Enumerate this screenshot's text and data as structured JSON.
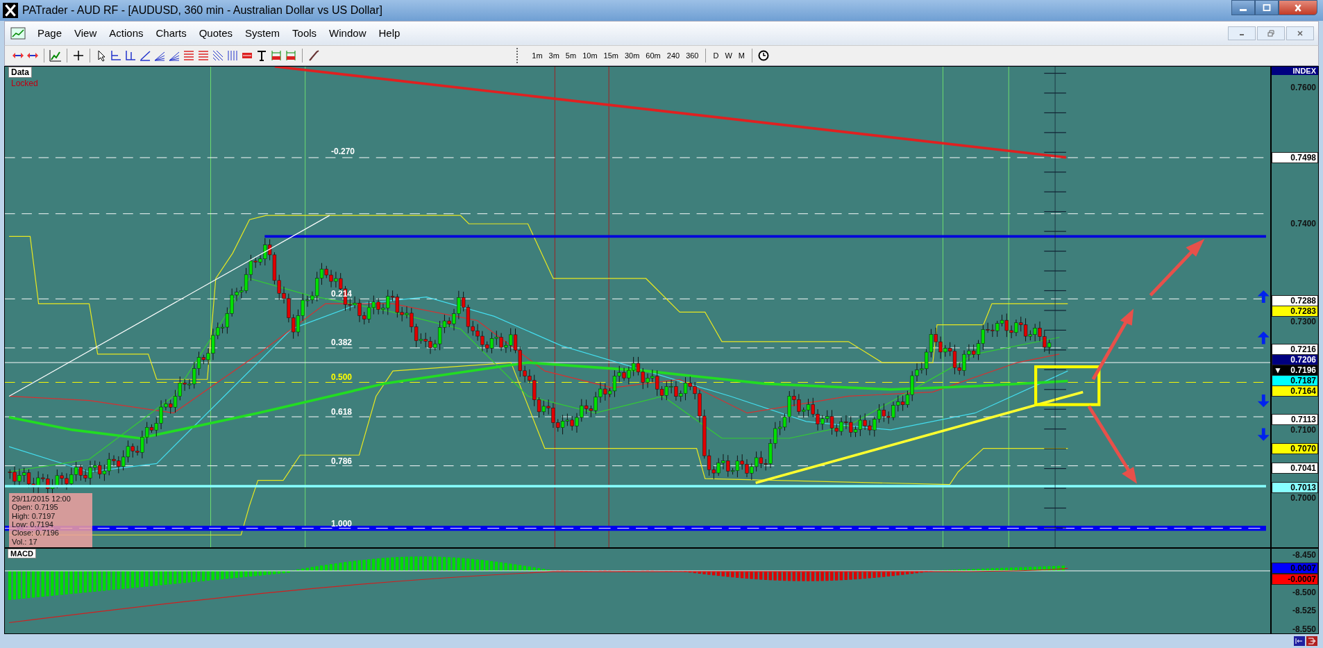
{
  "window": {
    "title": "PATrader - AUD RF - [AUDUSD, 360 min - Australian Dollar vs US Dollar]"
  },
  "menu": [
    "Page",
    "View",
    "Actions",
    "Charts",
    "Quotes",
    "System",
    "Tools",
    "Window",
    "Help"
  ],
  "timeframes": [
    "1m",
    "3m",
    "5m",
    "10m",
    "15m",
    "30m",
    "60m",
    "240",
    "360"
  ],
  "periods": [
    "D",
    "W",
    "M"
  ],
  "chart": {
    "data_tab": "Data",
    "lock_status": "Locked",
    "index_label": "INDEX",
    "axis_labels": [
      "0.7600",
      "0.7400",
      "0.7300",
      "0.7100",
      "0.7000"
    ],
    "price_tags": [
      {
        "text": "0.7498",
        "color": "#ffffff"
      },
      {
        "text": "0.7288",
        "color": "#ffffff"
      },
      {
        "text": "0.7283",
        "color": "#ffff00"
      },
      {
        "text": "0.7216",
        "color": "#ffffff"
      },
      {
        "text": "0.7206",
        "color": "#000080"
      },
      {
        "text": "0.7196",
        "color": "#000000",
        "marker": "▼"
      },
      {
        "text": "0.7187",
        "color": "#00ffff"
      },
      {
        "text": "0.7164",
        "color": "#ffff00"
      },
      {
        "text": "0.7113",
        "color": "#ffffff"
      },
      {
        "text": "0.7070",
        "color": "#ffff00"
      },
      {
        "text": "0.7041",
        "color": "#ffffff"
      },
      {
        "text": "0.7013",
        "color": "#88ffff"
      }
    ],
    "fib_labels": [
      {
        "text": "-0.270",
        "color": "#ffffff"
      },
      {
        "text": "0.214",
        "color": "#ffffff"
      },
      {
        "text": "0.382",
        "color": "#ffffff"
      },
      {
        "text": "0.500",
        "color": "#ffff00"
      },
      {
        "text": "0.618",
        "color": "#ffffff"
      },
      {
        "text": "0.786",
        "color": "#ffffff"
      },
      {
        "text": "1.000",
        "color": "#ffffff"
      }
    ],
    "data_box": [
      "29/11/2015 12:00",
      "Open: 0.7195",
      "High: 0.7197",
      "Low: 0.7194",
      "Close: 0.7196",
      "Vol.: 17"
    ]
  },
  "macd": {
    "tab": "MACD",
    "axis_labels": [
      "-8.450",
      "-8.500",
      "-8.525",
      "-8.550"
    ],
    "tags": [
      {
        "text": "0.0007",
        "color": "#0000ff"
      },
      {
        "text": "-0.0007",
        "color": "#ff0000"
      }
    ]
  }
}
